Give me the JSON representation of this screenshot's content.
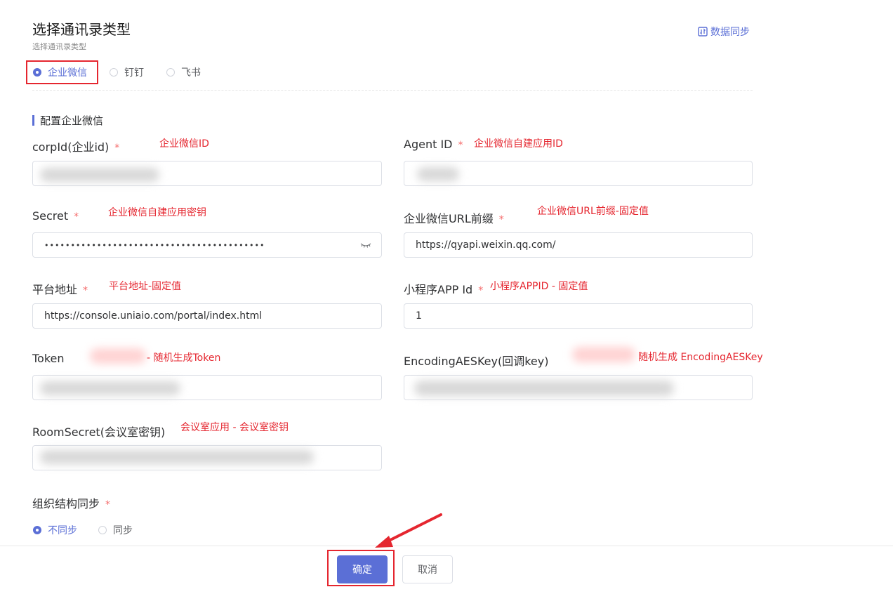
{
  "header": {
    "title": "选择通讯录类型",
    "subtitle": "选择通讯录类型",
    "sync_label": "数据同步"
  },
  "type_options": [
    {
      "label": "企业微信",
      "selected": true
    },
    {
      "label": "钉钉",
      "selected": false
    },
    {
      "label": "飞书",
      "selected": false
    }
  ],
  "section_title": "配置企业微信",
  "required_mark": "*",
  "fields": {
    "corpid": {
      "label": "corpId(企业id)",
      "note": "企业微信ID"
    },
    "agentid": {
      "label": "Agent ID",
      "note": "企业微信自建应用ID"
    },
    "secret": {
      "label": "Secret",
      "note": "企业微信自建应用密钥",
      "value": "••••••••••••••••••••••••••••••••••••••••••"
    },
    "urlprefix": {
      "label": "企业微信URL前缀",
      "note": "企业微信URL前缀-固定值",
      "value": "https://qyapi.weixin.qq.com/"
    },
    "platform": {
      "label": "平台地址",
      "note": "平台地址-固定值",
      "value": "https://console.uniaio.com/portal/index.html"
    },
    "miniapp": {
      "label": "小程序APP Id",
      "note": "小程序APPID - 固定值",
      "value": "1"
    },
    "token": {
      "label": "Token",
      "note": "- 随机生成Token"
    },
    "aeskey": {
      "label": "EncodingAESKey(回调key)",
      "note": "随机生成 EncodingAESKey"
    },
    "roomsecret": {
      "label": "RoomSecret(会议室密钥)",
      "note": "会议室应用 - 会议室密钥"
    }
  },
  "org_sync": {
    "label": "组织结构同步",
    "options": [
      {
        "label": "不同步",
        "selected": true
      },
      {
        "label": "同步",
        "selected": false
      }
    ]
  },
  "footer": {
    "confirm_label": "确定",
    "cancel_label": "取消"
  },
  "colors": {
    "primary": "#5b6fd6",
    "annotation": "#e5262f",
    "required": "#f56c6c"
  }
}
